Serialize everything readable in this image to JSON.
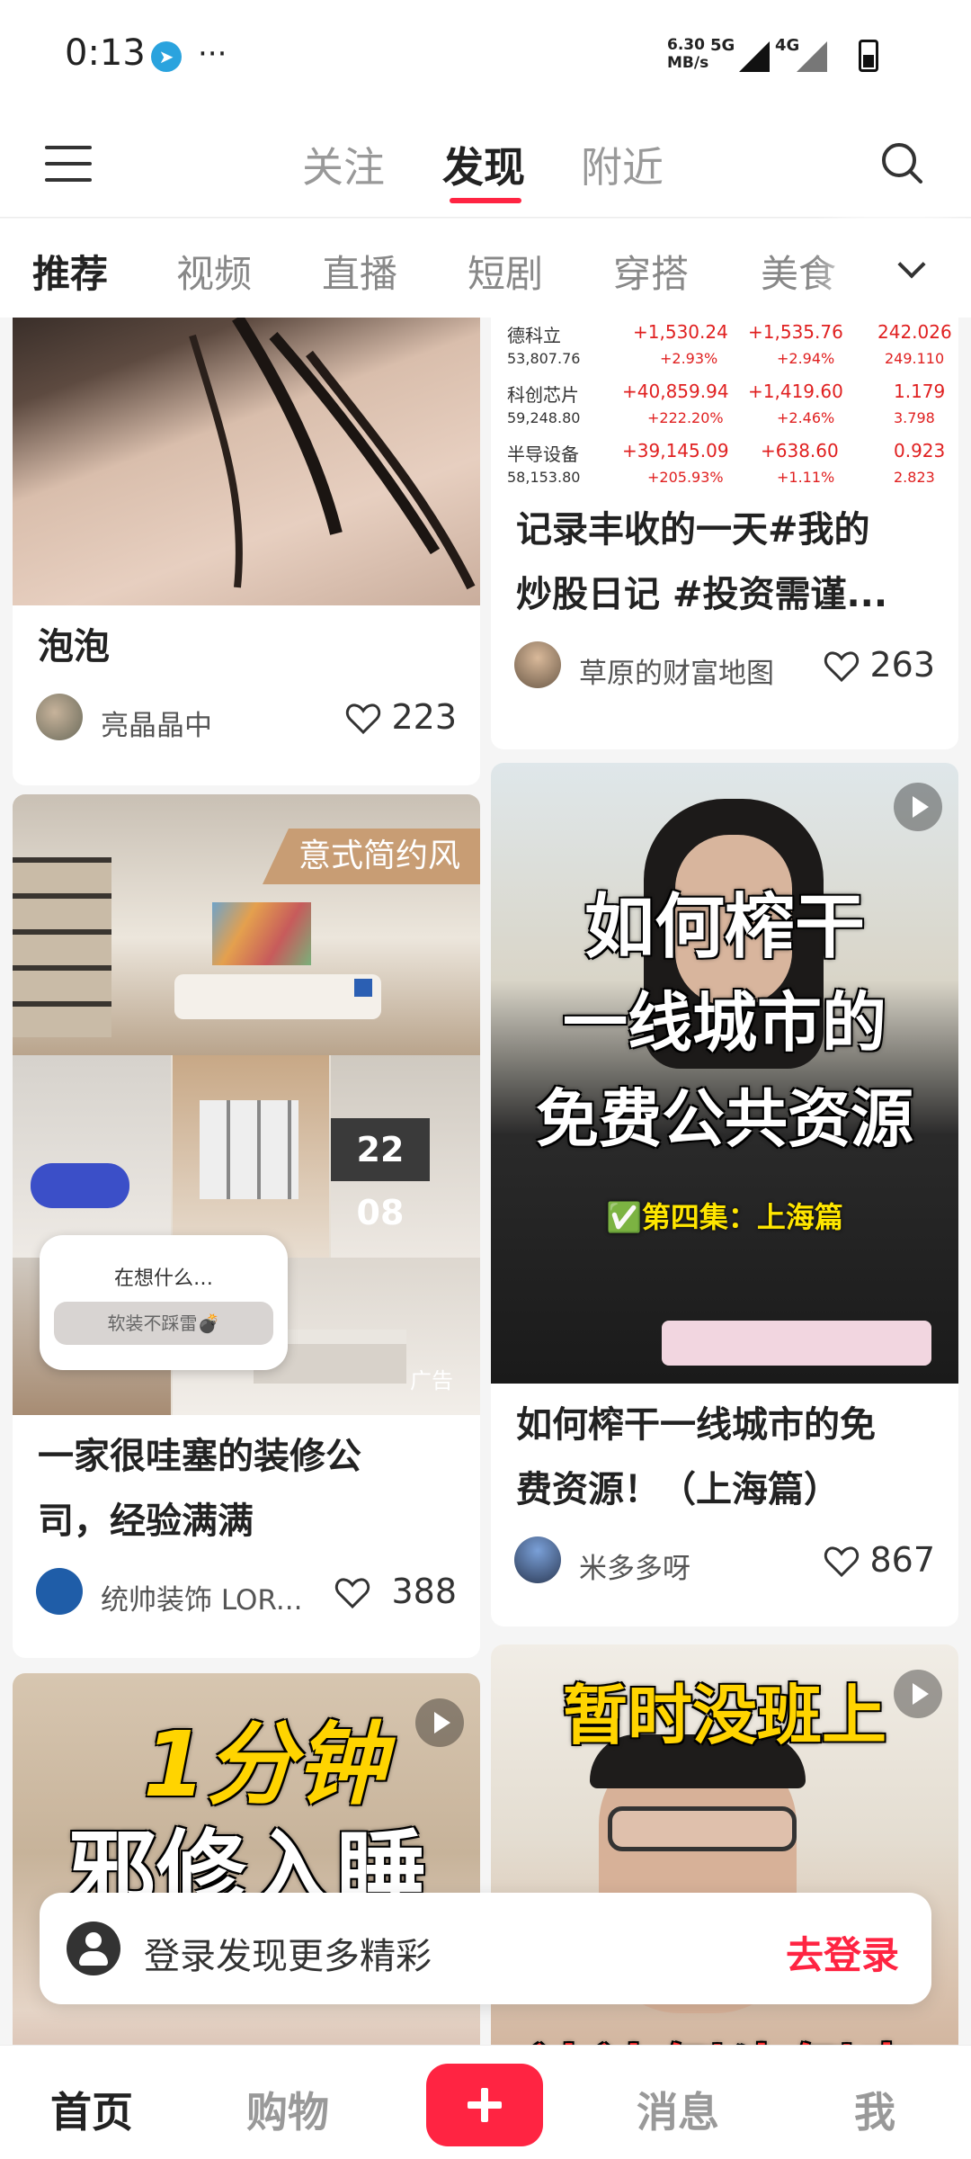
{
  "status_bar": {
    "time": "0:13",
    "dots": "···",
    "speed_value": "6.30",
    "speed_unit": "MB/s",
    "net_5g": "5G",
    "net_4g": "4G"
  },
  "top_nav": {
    "tabs": [
      "关注",
      "发现",
      "附近"
    ],
    "active_tab": "发现"
  },
  "categories": [
    "推荐",
    "视频",
    "直播",
    "短剧",
    "穿搭",
    "美食"
  ],
  "cards": [
    {
      "title": "泡泡",
      "author": "亮晶晶中",
      "likes": "223"
    },
    {
      "title_line1": "记录丰收的一天#我的",
      "title_line2": "炒股日记 #投资需谨...",
      "author": "草原的财富地图",
      "likes": "263",
      "stocks": [
        {
          "name": "德科立",
          "price": "53,807.76",
          "v1": "+1,530.24",
          "p1": "+2.93%",
          "v2": "+1,535.76",
          "p2": "+2.94%",
          "v3": "242.026",
          "v4": "249.110"
        },
        {
          "name": "科创芯片",
          "price": "59,248.80",
          "v1": "+40,859.94",
          "p1": "+222.20%",
          "v2": "+1,419.60",
          "p2": "+2.46%",
          "v3": "1.179",
          "v4": "3.798"
        },
        {
          "name": "半导设备",
          "price": "58,153.80",
          "v1": "+39,145.09",
          "p1": "+205.93%",
          "v2": "+638.60",
          "p2": "+1.11%",
          "v3": "0.923",
          "v4": "2.823"
        }
      ]
    },
    {
      "title_line1": "一家很哇塞的装修公",
      "title_line2": "司，经验满满",
      "author": "统帅装饰 LOR...",
      "likes": "388",
      "tag": "意式简约风",
      "clock": "22 08",
      "ad_question": "在想什么…",
      "ad_button": "软装不踩雷💣",
      "ad_mark": "广告"
    },
    {
      "title_line1": "如何榨干一线城市的免",
      "title_line2": "费资源！（上海篇）",
      "author": "米多多呀",
      "likes": "867",
      "overlay_line1": "如何榨干",
      "overlay_line2": "一线城市的",
      "overlay_line3": "免费公共资源",
      "overlay_sub": "✅第四集：上海篇"
    },
    {
      "overlay_line1": "1分钟",
      "overlay_line2": "邪修入睡"
    },
    {
      "overlay_line1": "暂时没班上",
      "overlay_line2": "边边倒头倒卖"
    }
  ],
  "login_banner": {
    "message": "登录发现更多精彩",
    "action": "去登录"
  },
  "bottom_nav": {
    "home": "首页",
    "shop": "购物",
    "messages": "消息",
    "me": "我"
  },
  "colors": {
    "accent": "#ff2442",
    "tag": "#c89d74",
    "overlay_yellow": "#ffe600"
  }
}
